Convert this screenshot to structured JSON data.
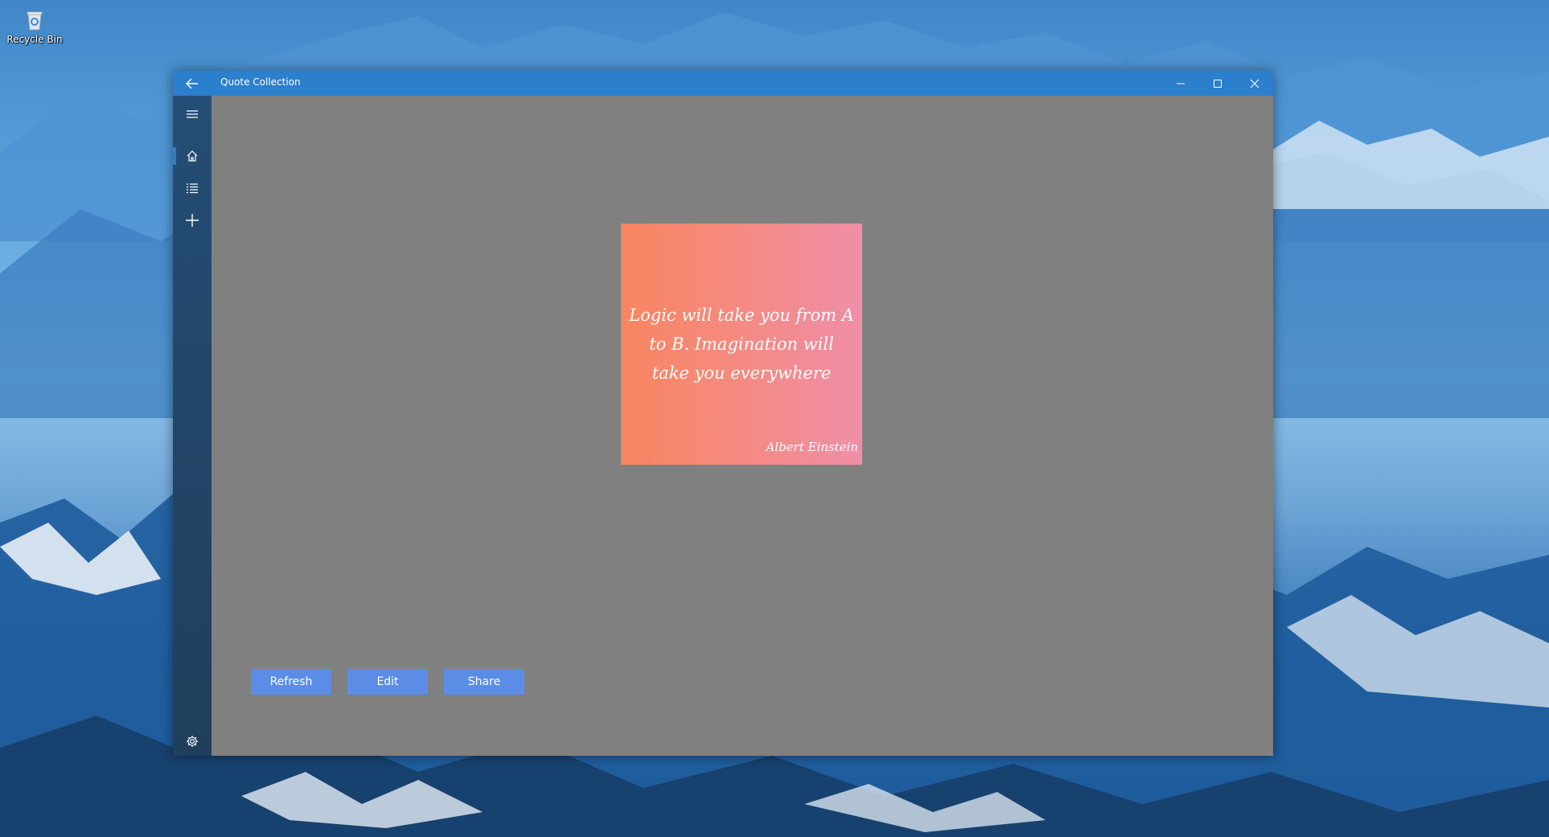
{
  "desktop": {
    "recycle_bin_label": "Recycle Bin"
  },
  "window": {
    "title": "Quote Collection",
    "title_bar_color": "#2b7fcc",
    "nav_color": "#22476a",
    "content_color": "#808080"
  },
  "nav": {
    "items": [
      {
        "icon": "hamburger-icon"
      },
      {
        "icon": "home-icon",
        "selected": true
      },
      {
        "icon": "list-icon"
      },
      {
        "icon": "add-icon"
      },
      {
        "icon": "gear-icon"
      }
    ]
  },
  "quote": {
    "text": "Logic will take you from A to B. Imagination will take you everywhere",
    "author": "Albert Einstein",
    "gradient_start": "#f88561",
    "gradient_end": "#ef8ea8"
  },
  "actions": {
    "refresh_label": "Refresh",
    "edit_label": "Edit",
    "share_label": "Share",
    "button_color": "#5b8de6"
  }
}
